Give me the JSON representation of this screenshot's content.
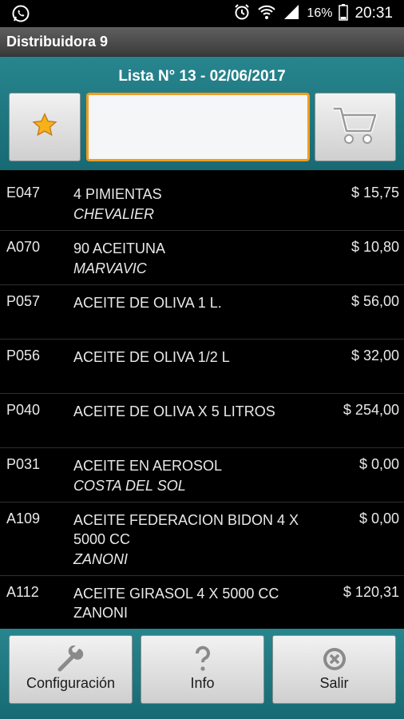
{
  "status_bar": {
    "battery": "16%",
    "time": "20:31"
  },
  "app": {
    "title": "Distribuidora 9"
  },
  "header": {
    "list_title": "Lista N° 13 - 02/06/2017",
    "search": {
      "value": "",
      "placeholder": ""
    }
  },
  "products": [
    {
      "code": "E047",
      "name": "4 PIMIENTAS",
      "brand": "CHEVALIER",
      "price": "$ 15,75"
    },
    {
      "code": "A070",
      "name": "90 ACEITUNA",
      "brand": "MARVAVIC",
      "price": "$ 10,80"
    },
    {
      "code": "P057",
      "name": "ACEITE DE OLIVA 1 L.",
      "brand": "",
      "price": "$ 56,00"
    },
    {
      "code": "P056",
      "name": "ACEITE DE OLIVA 1/2 L",
      "brand": "",
      "price": "$ 32,00"
    },
    {
      "code": "P040",
      "name": "ACEITE DE OLIVA X 5 LITROS",
      "brand": "",
      "price": "$ 254,00"
    },
    {
      "code": "P031",
      "name": "ACEITE EN AEROSOL",
      "brand": "COSTA DEL SOL",
      "price": "$ 0,00"
    },
    {
      "code": "A109",
      "name": "ACEITE FEDERACION BIDON 4 X 5000 CC",
      "brand": "ZANONI",
      "price": "$ 0,00"
    },
    {
      "code": "A112",
      "name": "ACEITE GIRASOL 4 X 5000 CC ZANONI",
      "brand": "",
      "price": "$ 120,31"
    }
  ],
  "bottom_bar": {
    "config_label": "Configuración",
    "info_label": "Info",
    "exit_label": "Salir"
  },
  "icons": {
    "favorite": "star-icon",
    "cart": "cart-icon",
    "config": "wrench-icon",
    "info": "question-icon",
    "exit": "close-circle-icon"
  },
  "colors": {
    "accent": "#f29c1f",
    "teal": "#1f7a83"
  }
}
